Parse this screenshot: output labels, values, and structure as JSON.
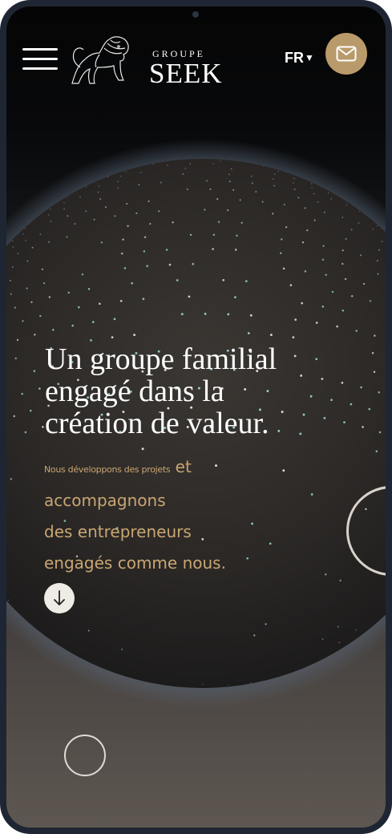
{
  "header": {
    "menu_icon": "hamburger-menu-icon",
    "logo": {
      "supertitle": "GROUPE",
      "title": "SEEK",
      "emblem": "lion-emblem-icon"
    },
    "language": {
      "selected": "FR",
      "caret_icon": "caret-down-icon"
    },
    "contact_icon": "mail-icon"
  },
  "hero": {
    "title_lines": [
      "Un groupe familial",
      "engagé dans la",
      "création de valeur."
    ],
    "subtitle_small": "Nous développons des projets",
    "subtitle_lines": [
      "et",
      "accompagnons",
      "des entrepreneurs",
      "engagés comme nous."
    ],
    "scroll_icon": "arrow-down-icon"
  },
  "colors": {
    "accent_gold": "#b99a6a",
    "subtitle_gold": "#c9a672",
    "frame": "#1f2633",
    "text_white": "#ffffff",
    "globe_dots": "#9fd6d4"
  }
}
